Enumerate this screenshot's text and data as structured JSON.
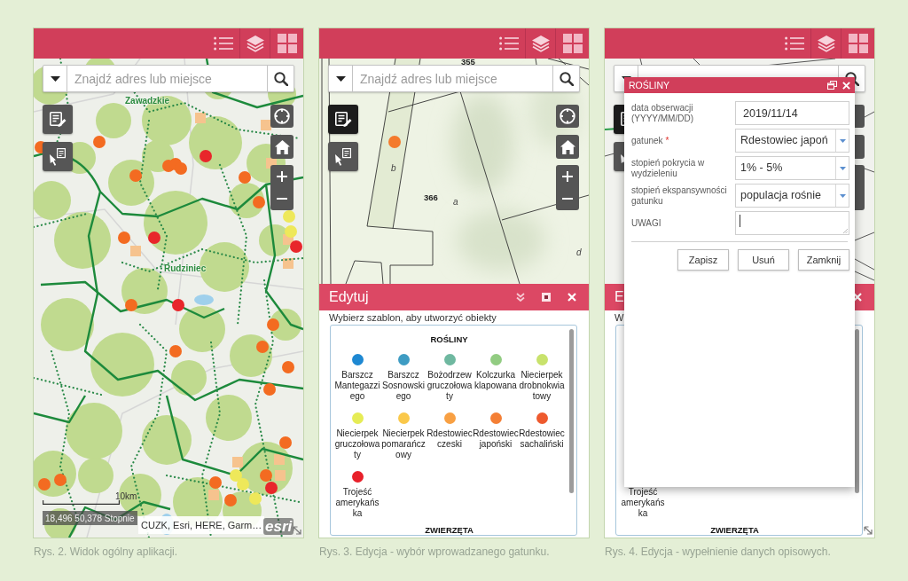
{
  "figures": [
    {
      "kind": "overview",
      "search": {
        "placeholder": "Znajdź adres lub miejsce"
      },
      "tools": [
        {
          "kind": "edit",
          "selected": false
        },
        {
          "kind": "select",
          "selected": false
        }
      ],
      "map": {
        "kind": "overview",
        "labels": [
          {
            "kind": "town",
            "text": "Zawadzkie"
          },
          {
            "kind": "town",
            "text": "Rudziniec"
          }
        ]
      },
      "scale_label": "10km",
      "coordinates": "18,496 50,378 Stopnie",
      "attribution": "CUZK, Esri, HERE, Garm…",
      "logo": "esri",
      "caption": "Rys. 2. Widok ogólny aplikacji."
    },
    {
      "kind": "template-picker",
      "search": {
        "placeholder": "Znajdź adres lub miejsce"
      },
      "tools": [
        {
          "kind": "edit",
          "selected": true
        },
        {
          "kind": "select",
          "selected": false
        }
      ],
      "map": {
        "kind": "parcels",
        "labels": [
          {
            "kind": "parcel",
            "text": "355"
          },
          {
            "kind": "parcel",
            "text": "366"
          },
          {
            "kind": "subdivision",
            "text": "a"
          },
          {
            "kind": "subdivision",
            "text": "b"
          },
          {
            "kind": "subdivision",
            "text": "d"
          }
        ]
      },
      "editor": {
        "title": "Edytuj",
        "hint": "Wybierz szablon, aby utworzyć obiekty",
        "groups": [
          {
            "heading": "ROŚLINY",
            "templates": [
              {
                "label": "Barszcz Mantegazziego",
                "color": "#1e88d2"
              },
              {
                "label": "Barszcz Sosnowskiego",
                "color": "#3e9cc3"
              },
              {
                "label": "Bożodrzew gruczołowaty",
                "color": "#6fb8a0"
              },
              {
                "label": "Kolczurka klapowana",
                "color": "#92cc82"
              },
              {
                "label": "Niecierpek drobnokwiatowy",
                "color": "#c8e26c"
              },
              {
                "label": "Niecierpek gruczołowaty",
                "color": "#e6ec55"
              },
              {
                "label": "Niecierpek pomarańczowy",
                "color": "#fac84a"
              },
              {
                "label": "Rdestowiec czeski",
                "color": "#f8a043"
              },
              {
                "label": "Rdestowiec japoński",
                "color": "#f47f35"
              },
              {
                "label": "Rdestowiec sachaliński",
                "color": "#ee5a2e"
              },
              {
                "label": "Trojeść amerykańska",
                "color": "#e8202a"
              }
            ]
          },
          {
            "heading": "ZWIERZĘTA"
          }
        ]
      },
      "caption": "Rys. 3. Edycja - wybór wprowadzanego gatunku."
    },
    {
      "kind": "attribute-form",
      "tools": [
        {
          "kind": "edit",
          "selected": true
        },
        {
          "kind": "select",
          "selected": false
        }
      ],
      "map": {
        "kind": "detail"
      },
      "editor": {
        "title": "E",
        "hint": "W",
        "groups": [
          {
            "templates": [
              {
                "label": "Trojeść amerykańska"
              }
            ]
          },
          {
            "heading": "ZWIERZĘTA"
          }
        ]
      },
      "dialog": {
        "title": "ROŚLINY",
        "fields": [
          {
            "kind": "text",
            "label": "data obserwacji (YYYY/MM/DD)",
            "value": "2019/11/14"
          },
          {
            "kind": "select",
            "label": "gatunek",
            "required_mark": "*",
            "value": "Rdestowiec japoń"
          },
          {
            "kind": "select",
            "label": "stopień pokrycia w wydzieleniu",
            "value": "1% - 5%"
          },
          {
            "kind": "select",
            "label": "stopień ekspansywności gatunku",
            "value": "populacja rośnie"
          },
          {
            "kind": "textarea",
            "label": "UWAGI",
            "focused": true
          }
        ],
        "buttons": [
          "Zapisz",
          "Usuń",
          "Zamknij"
        ]
      },
      "caption": "Rys. 4. Edycja - wypełnienie danych opisowych."
    }
  ]
}
